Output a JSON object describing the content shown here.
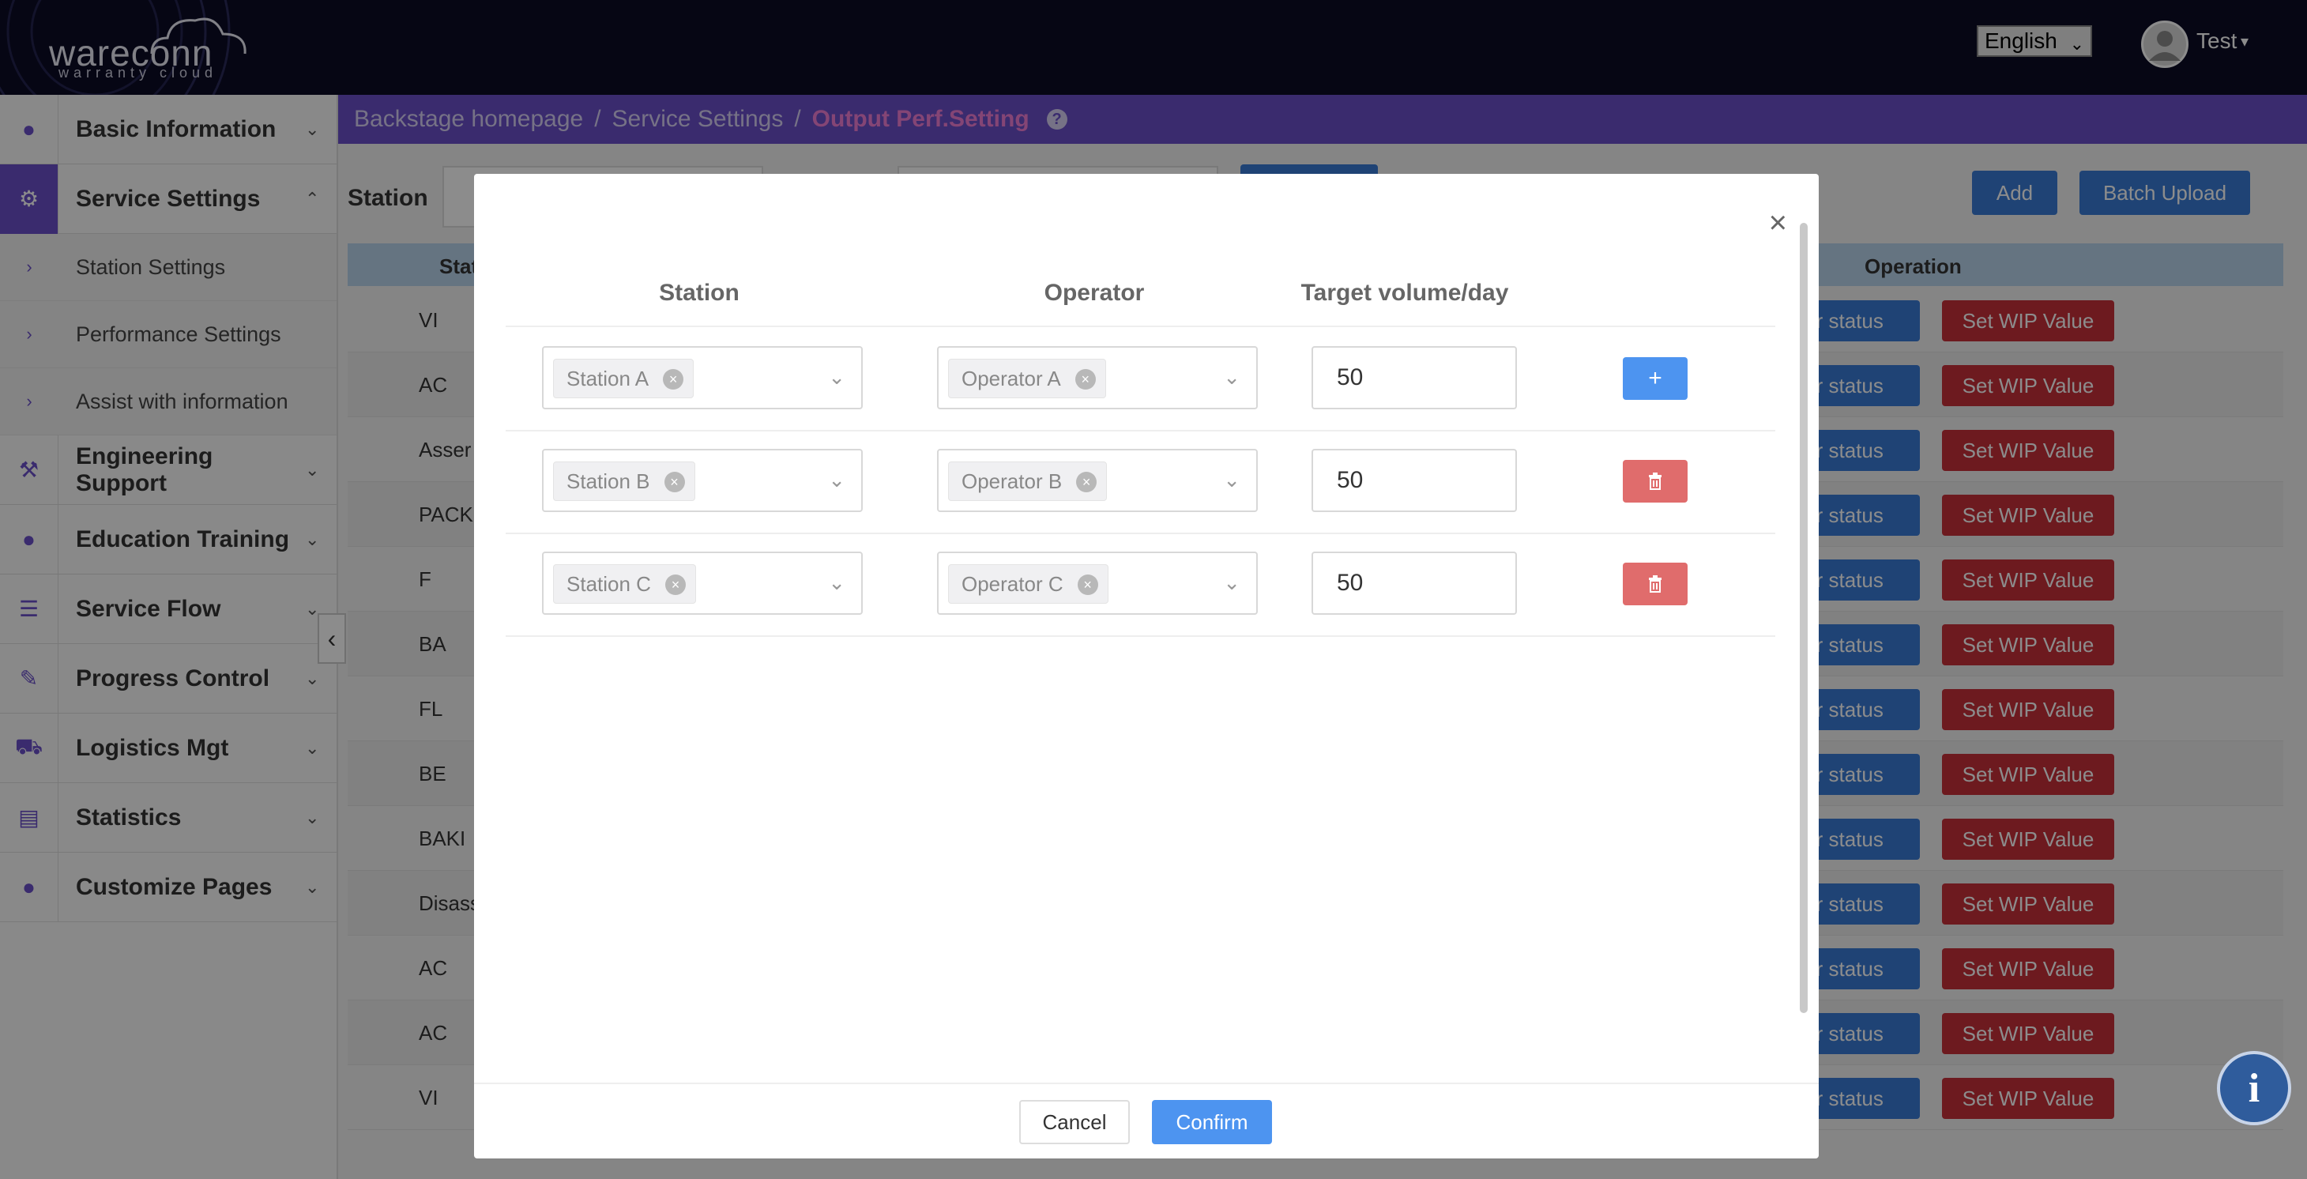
{
  "header": {
    "logo_main": "wareconn",
    "logo_sub": "warranty cloud",
    "language": "English",
    "user": "Test"
  },
  "sidebar": {
    "items": [
      {
        "label": "Basic Information",
        "icon": "user-icon"
      },
      {
        "label": "Service Settings",
        "icon": "gear-icon"
      },
      {
        "label": "Engineering Support",
        "icon": "wrench-icon"
      },
      {
        "label": "Education Training",
        "icon": "user-icon"
      },
      {
        "label": "Service Flow",
        "icon": "list-icon"
      },
      {
        "label": "Progress Control",
        "icon": "pencil-icon"
      },
      {
        "label": "Logistics Mgt",
        "icon": "truck-icon"
      },
      {
        "label": "Statistics",
        "icon": "bar-chart-icon"
      },
      {
        "label": "Customize Pages",
        "icon": "user-icon"
      }
    ],
    "subitems": [
      "Station Settings",
      "Performance Settings",
      "Assist with information"
    ]
  },
  "breadcrumb": {
    "home": "Backstage homepage",
    "section": "Service Settings",
    "current": "Output Perf.Setting",
    "help_icon": "?"
  },
  "page": {
    "station_label": "Station",
    "add_label": "Add",
    "batch_upload_label": "Batch Upload",
    "col_station": "Stat",
    "col_operation": "Operation",
    "row_btn_status": "or status",
    "row_btn_wip": "Set WIP Value",
    "rows": [
      "VI",
      "AC",
      "Asser",
      "PACK",
      "F",
      "BA",
      "FL",
      "BE",
      "BAKI",
      "Disass",
      "AC",
      "AC",
      "VI"
    ]
  },
  "modal": {
    "col_station": "Station",
    "col_operator": "Operator",
    "col_target": "Target volume/day",
    "close": "×",
    "rows": [
      {
        "station": "Station A",
        "operator": "Operator A",
        "target": "50",
        "action": "add"
      },
      {
        "station": "Station B",
        "operator": "Operator B",
        "target": "50",
        "action": "delete"
      },
      {
        "station": "Station C",
        "operator": "Operator C",
        "target": "50",
        "action": "delete"
      }
    ],
    "cancel": "Cancel",
    "confirm": "Confirm"
  },
  "colors": {
    "topbar": "#0b0b26",
    "accent_purple": "#6a4fc8",
    "breadcrumb_current": "#f07fd5",
    "primary_blue": "#3a7bd5",
    "danger_red": "#c6303a",
    "modal_add_blue": "#4d94f0",
    "modal_delete_red": "#e06c6c"
  }
}
